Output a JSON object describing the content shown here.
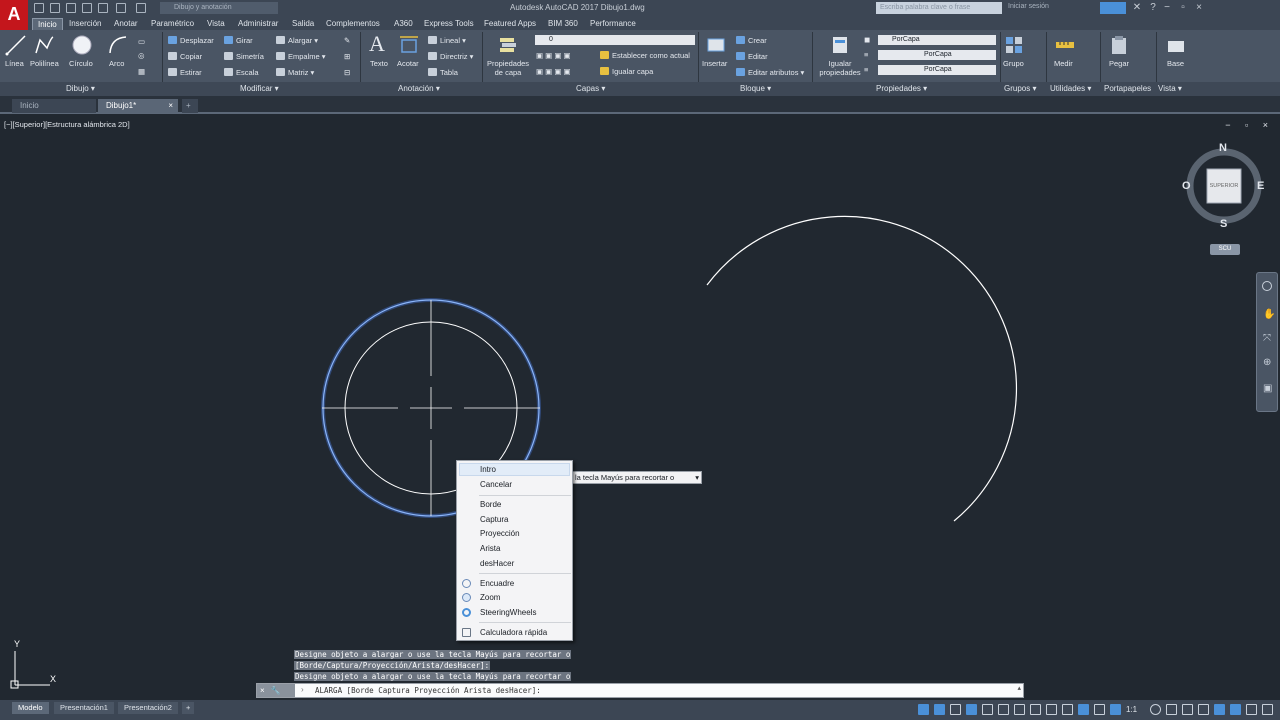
{
  "app": {
    "title": "Autodesk AutoCAD 2017   Dibujo1.dwg",
    "logo": "A",
    "workspace": "Dibujo y anotación",
    "search_placeholder": "Escriba palabra clave o frase",
    "signin": "Iniciar sesión"
  },
  "ribbon_tabs": [
    "Inicio",
    "Inserción",
    "Anotar",
    "Paramétrico",
    "Vista",
    "Administrar",
    "Salida",
    "Complementos",
    "A360",
    "Express Tools",
    "Featured Apps",
    "BIM 360",
    "Performance"
  ],
  "ribbon": {
    "draw": {
      "linea": "Línea",
      "polilinea": "Polilínea",
      "circulo": "Círculo",
      "arco": "Arco",
      "title": "Dibujo"
    },
    "modify": {
      "desplazar": "Desplazar",
      "girar": "Girar",
      "alargar": "Alargar",
      "copiar": "Copiar",
      "simetria": "Simetría",
      "empalme": "Empalme",
      "estirar": "Estirar",
      "escala": "Escala",
      "matriz": "Matriz",
      "title": "Modificar"
    },
    "annotation": {
      "texto": "Texto",
      "acotar": "Acotar",
      "lineal": "Lineal",
      "directriz": "Directriz",
      "tabla": "Tabla",
      "title": "Anotación"
    },
    "layers": {
      "propiedades": "Propiedades de capa",
      "layer_value": "0",
      "establecer": "Establecer como actual",
      "igualar": "Igualar capa",
      "title": "Capas"
    },
    "block": {
      "insertar": "Insertar",
      "crear": "Crear",
      "editar": "Editar",
      "editar_atributos": "Editar atributos",
      "title": "Bloque"
    },
    "properties": {
      "igualar": "Igualar propiedades",
      "color": "PorCapa",
      "linetype": "PorCapa",
      "lineweight": "PorCapa",
      "title": "Propiedades"
    },
    "groups": {
      "grupo": "Grupo",
      "title": "Grupos"
    },
    "utilities": {
      "medir": "Medir",
      "title": "Utilidades"
    },
    "clipboard": {
      "pegar": "Pegar",
      "title": "Portapapeles"
    },
    "view": {
      "base": "Base",
      "title": "Vista"
    }
  },
  "doc_tabs": [
    "Inicio",
    "Dibujo1*"
  ],
  "viewport": {
    "label": "[−][Superior][Estructura alámbrica 2D]",
    "controls": "− ▫ ×"
  },
  "viewcube": {
    "n": "N",
    "s": "S",
    "e": "E",
    "o": "O",
    "face": "SUPERIOR",
    "wcs": "SCU"
  },
  "ucs": {
    "y": "Y",
    "x": "X"
  },
  "context_menu": [
    {
      "label": "Intro",
      "highlighted": true
    },
    {
      "label": "Cancelar"
    },
    {
      "label": "Borde"
    },
    {
      "label": "Captura"
    },
    {
      "label": "Proyección"
    },
    {
      "label": "Arista"
    },
    {
      "label": "desHacer"
    },
    {
      "label": "Encuadre",
      "icon": "pan-icon"
    },
    {
      "label": "Zoom",
      "icon": "zoom-icon"
    },
    {
      "label": "SteeringWheels",
      "icon": "steeringwheels-icon"
    },
    {
      "label": "Calculadora rápida",
      "icon": "calculator-icon"
    }
  ],
  "tooltip": "la tecla Mayús para recortar o",
  "command_history": [
    "Designe objeto a alargar o use la tecla Mayús para recortar o",
    "[Borde/Captura/Proyección/Arista/desHacer]:",
    "Designe objeto a alargar o use la tecla Mayús para recortar o"
  ],
  "command_line": {
    "text": "ALARGA [Borde Captura Proyección Arista desHacer]:",
    "buttons": "× 🔧"
  },
  "layout_tabs": [
    "Modelo",
    "Presentación1",
    "Presentación2"
  ],
  "status": {
    "scale": "1:1"
  },
  "colors": {
    "canvas": "#212830",
    "ribbon": "#4a5564",
    "selection_blue": "#5a8ee8",
    "logo_red": "#c4161c"
  }
}
